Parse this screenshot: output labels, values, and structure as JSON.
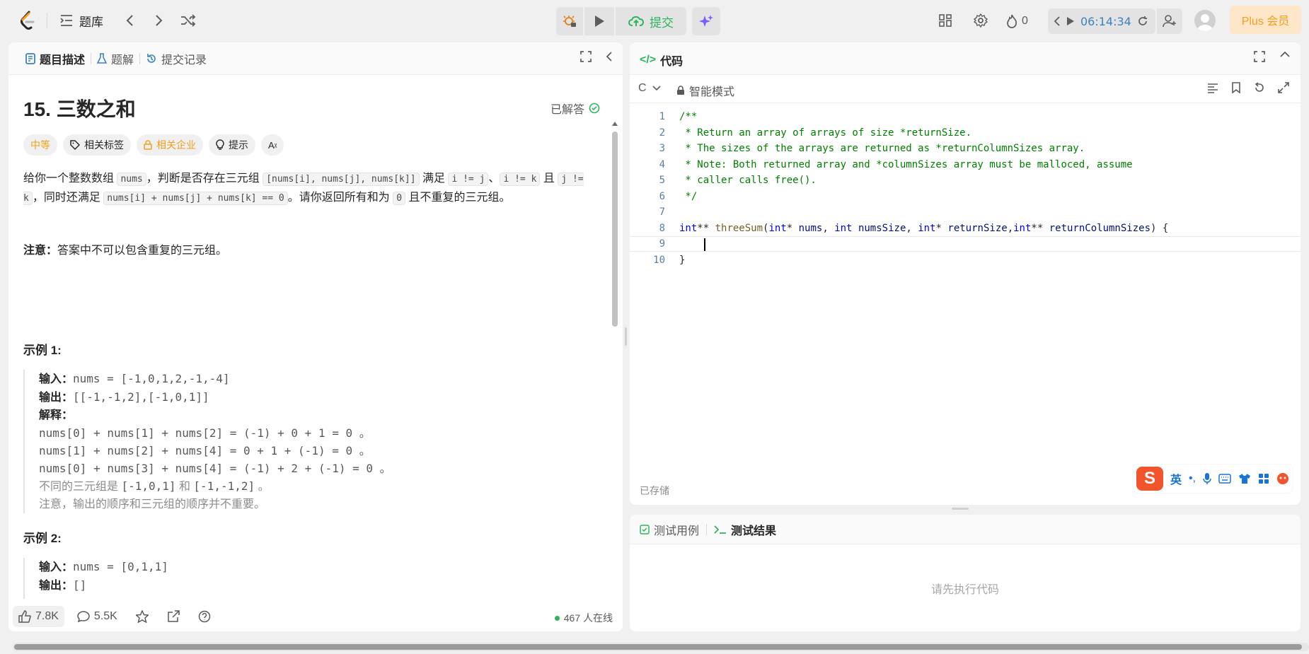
{
  "topbar": {
    "problem_list": "题库",
    "submit": "提交",
    "fire_count": "0",
    "timer": "06:14:34",
    "plus": "Plus 会员"
  },
  "left": {
    "tabs": [
      "题目描述",
      "题解",
      "提交记录"
    ],
    "title": "15. 三数之和",
    "solved": "已解答",
    "tags": [
      "中等",
      "相关标签",
      "相关企业",
      "提示",
      "Aあ"
    ],
    "desc_parts": [
      "给你一个整数数组 ",
      "nums",
      "，判断是否存在三元组 ",
      "[nums[i], nums[j], nums[k]]",
      " 满足 ",
      "i != j",
      "、",
      "i != k",
      " 且 ",
      "j != k",
      "，同时还满足 ",
      "nums[i] + nums[j] + nums[k] == 0",
      "。请你返回所有和为 ",
      "0",
      " 且不重复的三元组。"
    ],
    "note_label": "注意：",
    "note_text": "答案中不可以包含重复的三元组。",
    "ex1_title": "示例 1:",
    "ex1": {
      "input_label": "输入：",
      "input": "nums = [-1,0,1,2,-1,-4]",
      "output_label": "输出：",
      "output": "[[-1,-1,2],[-1,0,1]]",
      "explain_label": "解释：",
      "lines": [
        "nums[0] + nums[1] + nums[2] = (-1) + 0 + 1 = 0 。",
        "nums[1] + nums[2] + nums[4] = 0 + 1 + (-1) = 0 。",
        "nums[0] + nums[3] + nums[4] = (-1) + 2 + (-1) = 0 。"
      ],
      "distinct_pre": "不同的三元组是 ",
      "distinct_a": "[-1,0,1]",
      "distinct_mid": " 和 ",
      "distinct_b": "[-1,-1,2]",
      "distinct_post": " 。",
      "order_note": "注意，输出的顺序和三元组的顺序并不重要。"
    },
    "ex2_title": "示例 2:",
    "ex2": {
      "input_label": "输入：",
      "input": "nums = [0,1,1]",
      "output_label": "输出：",
      "output": "[]"
    },
    "likes": "7.8K",
    "comments": "5.5K",
    "online": "467 人在线"
  },
  "code": {
    "title": "代码",
    "lang": "C",
    "mode": "智能模式",
    "lines": [
      "/**",
      " * Return an array of arrays of size *returnSize.",
      " * The sizes of the arrays are returned as *returnColumnSizes array.",
      " * Note: Both returned array and *columnSizes array must be malloced, assume",
      " * caller calls free().",
      " */",
      "",
      "int** threeSum(int* nums, int numsSize, int* returnSize,int** returnColumnSizes) {",
      "    ",
      "}"
    ],
    "saved": "已存储",
    "ime_lang": "英"
  },
  "result": {
    "tabs": [
      "测试用例",
      "测试结果"
    ],
    "empty": "请先执行代码"
  },
  "colors": {
    "accent_green": "#2db55d",
    "orange": "#f0a020",
    "timer_blue": "#3b82c4"
  }
}
